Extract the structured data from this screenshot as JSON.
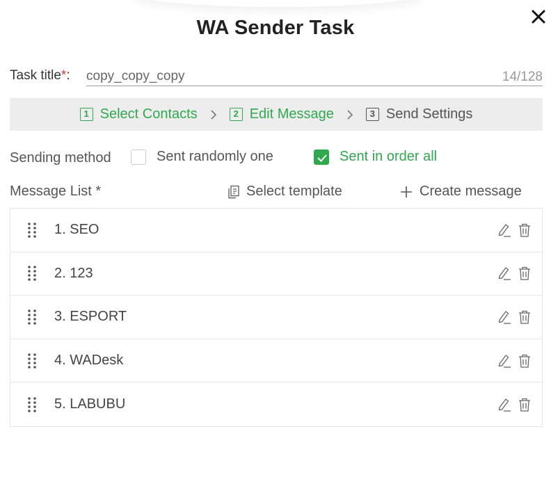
{
  "dialog": {
    "title": "WA Sender Task",
    "close_icon": "close-icon"
  },
  "task": {
    "label": "Task title",
    "required_mark": "*",
    "colon": ":",
    "value": "copy_copy_copy",
    "counter": "14/128"
  },
  "steps": [
    {
      "number": "1",
      "label": "Select Contacts",
      "state": "active"
    },
    {
      "number": "2",
      "label": "Edit Message",
      "state": "active"
    },
    {
      "number": "3",
      "label": "Send Settings",
      "state": "inactive"
    }
  ],
  "sending_method": {
    "label": "Sending method",
    "options": [
      {
        "label": "Sent randomly one",
        "checked": false
      },
      {
        "label": "Sent in order all",
        "checked": true
      }
    ]
  },
  "message_list": {
    "label": "Message List *",
    "select_template": "Select template",
    "create_message": "Create message",
    "items": [
      {
        "name": "1. SEO"
      },
      {
        "name": "2. 123"
      },
      {
        "name": "3. ESPORT"
      },
      {
        "name": "4. WADesk"
      },
      {
        "name": "5. LABUBU"
      }
    ]
  },
  "colors": {
    "accent": "#2fa84f",
    "required": "#e53935",
    "steps_bg": "#ededed"
  }
}
